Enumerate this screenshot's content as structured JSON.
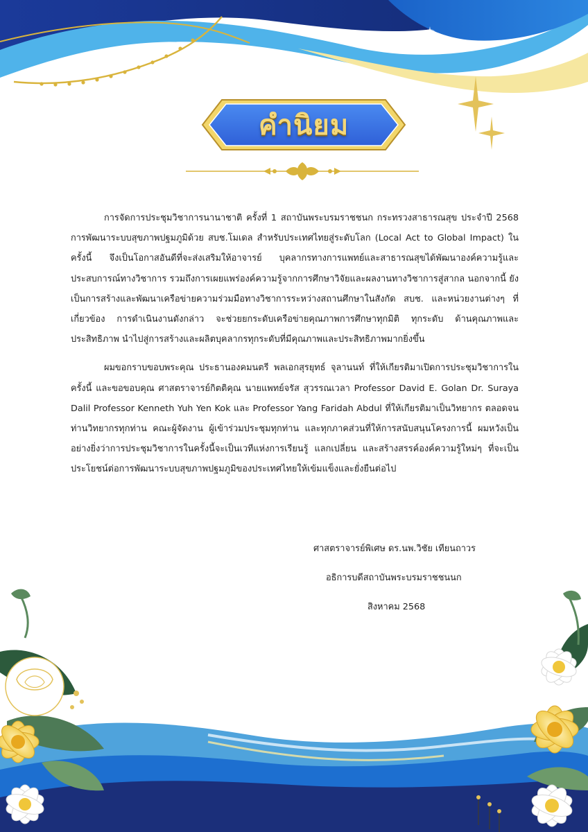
{
  "page": {
    "title": "คำนิยม"
  },
  "body": {
    "paragraph_1": "การจัดการประชุมวิชาการนานาชาติ ครั้งที่ 1 สถาบันพระบรมราชชนก กระทรวงสาธารณสุข ประจำปี 2568 การพัฒนาระบบสุขภาพปฐมภูมิด้วย สบช.โมเดล สำหรับประเทศไทยสู่ระดับโลก (Local Act to Global Impact) ในครั้งนี้ จึงเป็นโอกาสอันดีที่จะส่งเสริมให้อาจารย์ บุคลากรทางการแพทย์และสาธารณสุขได้พัฒนาองค์ความรู้และประสบการณ์ทางวิชาการ รวมถึงการเผยแพร่องค์ความรู้จากการศึกษาวิจัยและผลงานทางวิชาการสู่สากล นอกจากนี้ ยังเป็นการสร้างและพัฒนาเครือข่ายความร่วมมือทางวิชาการระหว่างสถานศึกษาในสังกัด สบช. และหน่วยงานต่างๆ ที่เกี่ยวข้อง การดำเนินงานดังกล่าว จะช่วยยกระดับเครือข่ายคุณภาพการศึกษาทุกมิติ ทุกระดับ ด้านคุณภาพและประสิทธิภาพ นำไปสู่การสร้างและผลิตบุคลากรทุกระดับที่มีคุณภาพและประสิทธิภาพมากยิ่งขึ้น",
    "paragraph_2": "ผมขอกราบขอบพระคุณ ประธานองคมนตรี พลเอกสุรยุทธ์ จุลานนท์ ที่ให้เกียรติมาเปิดการประชุมวิชาการในครั้งนี้ และขอขอบคุณ ศาสตราจารย์กิตติคุณ นายแพทย์จรัส สุวรรณเวลา Professor David E. Golan Dr. Suraya Dalil Professor Kenneth Yuh Yen Kok และ Professor Yang Faridah Abdul ที่ให้เกียรติมาเป็นวิทยากร ตลอดจนท่านวิทยากรทุกท่าน คณะผู้จัดงาน ผู้เข้าร่วมประชุมทุกท่าน และทุกภาคส่วนที่ให้การสนับสนุนโครงการนี้ ผมหวังเป็นอย่างยิ่งว่าการประชุมวิชาการในครั้งนี้จะเป็นเวทีแห่งการเรียนรู้ แลกเปลี่ยน และสร้างสรรค์องค์ความรู้ใหม่ๆ ที่จะเป็นประโยชน์ต่อการพัฒนาระบบสุขภาพปฐมภูมิของประเทศไทยให้เข้มแข็งและยั่งยืนต่อไป"
  },
  "signature": {
    "name": "ศาสตราจารย์พิเศษ ดร.นพ.วิชัย เทียนถาวร",
    "position": "อธิการบดีสถาบันพระบรมราชชนนก",
    "date": "สิงหาคม 2568"
  },
  "colors": {
    "navy": "#1b2f7a",
    "blue": "#1d6fd0",
    "light_blue": "#4fb3ea",
    "gold": "#d9b43c",
    "pale_yellow": "#f6e7a0"
  }
}
